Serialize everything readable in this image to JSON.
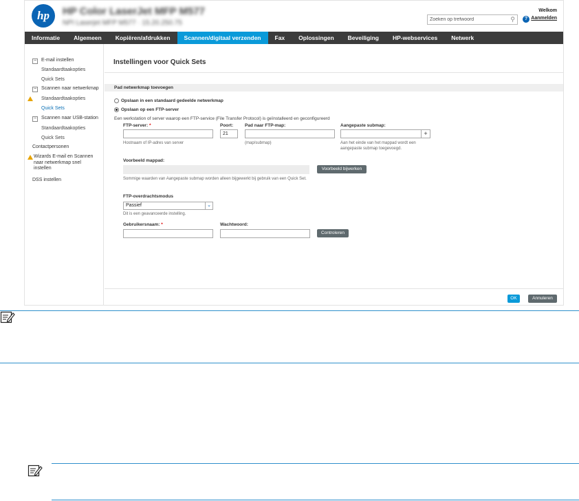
{
  "header": {
    "printer_name": "HP Color LaserJet MFP M577",
    "printer_subtitle": "NPI Laserjet MFP M577 · 15.20.250.75",
    "search_placeholder": "Zoeken op trefwoord",
    "welcome": "Welkom",
    "signin": "Aanmelden"
  },
  "nav": {
    "tabs": [
      {
        "label": "Informatie"
      },
      {
        "label": "Algemeen"
      },
      {
        "label": "Kopiëren/afdrukken"
      },
      {
        "label": "Scannen/digitaal verzenden",
        "active": true
      },
      {
        "label": "Fax"
      },
      {
        "label": "Oplossingen"
      },
      {
        "label": "Beveiliging"
      },
      {
        "label": "HP-webservices"
      },
      {
        "label": "Netwerk"
      }
    ]
  },
  "sidebar": {
    "items": [
      {
        "label": "E-mail instellen",
        "toggle": "−"
      },
      {
        "label": "Standaardtaakopties"
      },
      {
        "label": "Quick Sets"
      },
      {
        "label": "Scannen naar netwerkmap",
        "toggle": "−"
      },
      {
        "label": "Standaardtaakopties",
        "warning": true
      },
      {
        "label": "Quick Sets",
        "active": true
      },
      {
        "label": "Scannen naar USB-station",
        "toggle": "−"
      },
      {
        "label": "Standaardtaakopties"
      },
      {
        "label": "Quick Sets"
      },
      {
        "label": "Contactpersonen"
      },
      {
        "label": "Wizards E-mail en Scannen naar netwerkmap snel instellen",
        "warning": true
      },
      {
        "label": "DSS instellen"
      }
    ]
  },
  "main": {
    "title": "Instellingen voor Quick Sets",
    "section_title": "Pad netwerkmap toevoegen",
    "radio_shared": "Opslaan in een standaard gedeelde netwerkmap",
    "radio_ftp": "Opslaan op een FTP-server",
    "description": "Een werkstation of server waarop een FTP-service (File Transfer Protocol) is geïnstalleerd en geconfigureerd",
    "ftp_server_label": "FTP-server:",
    "required_mark": "*",
    "ftp_server_hint": "Hostnaam of IP-adres van server",
    "port_label": "Poort:",
    "port_value": "21",
    "ftp_path_label": "Pad naar FTP-map:",
    "ftp_path_hint": "(map/submap)",
    "custom_subfolder_label": "Aangepaste submap:",
    "custom_subfolder_hint": "Aan het einde van het mappad wordt een aangepaste submap toegevoegd.",
    "plus_label": "+",
    "preview_label": "Voorbeeld mappad:",
    "preview_button": "Voorbeeld bijwerken",
    "preview_hint": "Sommige waarden van Aangepaste submap worden alleen bijgewerkt bij gebruik van een Quick Set.",
    "transfer_mode_label": "FTP-overdrachtsmodus",
    "transfer_mode_value": "Passief",
    "transfer_mode_hint": "Dit is een geavanceerde instelling.",
    "username_label": "Gebruikersnaam:",
    "password_label": "Wachtwoord:",
    "verify_button": "Controleren",
    "ok_button": "OK",
    "cancel_button": "Annuleren"
  },
  "colors": {
    "hp_blue": "#0a64b4",
    "active_tab": "#0a9ad9",
    "nav_bg": "#3c3c3c",
    "warning": "#e8a400",
    "note_rule": "#2e8fcc"
  }
}
